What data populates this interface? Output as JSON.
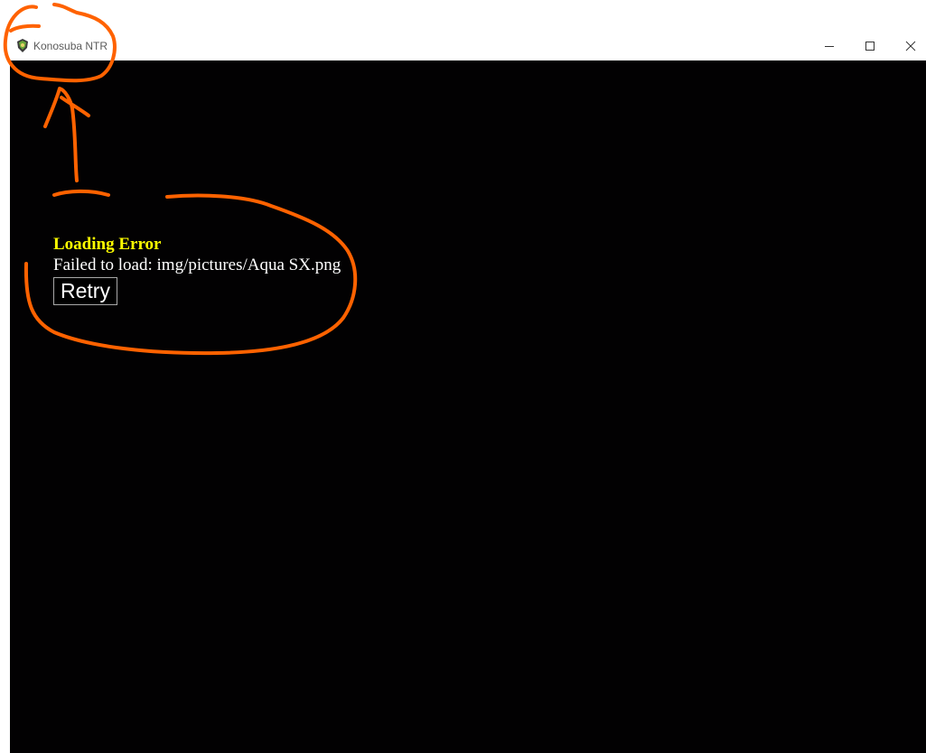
{
  "window": {
    "title": "Konosuba NTR",
    "controls": {
      "minimize_icon": "minimize-icon",
      "maximize_icon": "maximize-icon",
      "close_icon": "close-icon"
    }
  },
  "error": {
    "title": "Loading Error",
    "message": "Failed to load: img/pictures/Aqua SX.png",
    "retry_label": "Retry"
  },
  "colors": {
    "viewport_background": "#020102",
    "error_title": "#ffff00",
    "error_message": "#ffffff",
    "annotation": "#ff6200"
  }
}
